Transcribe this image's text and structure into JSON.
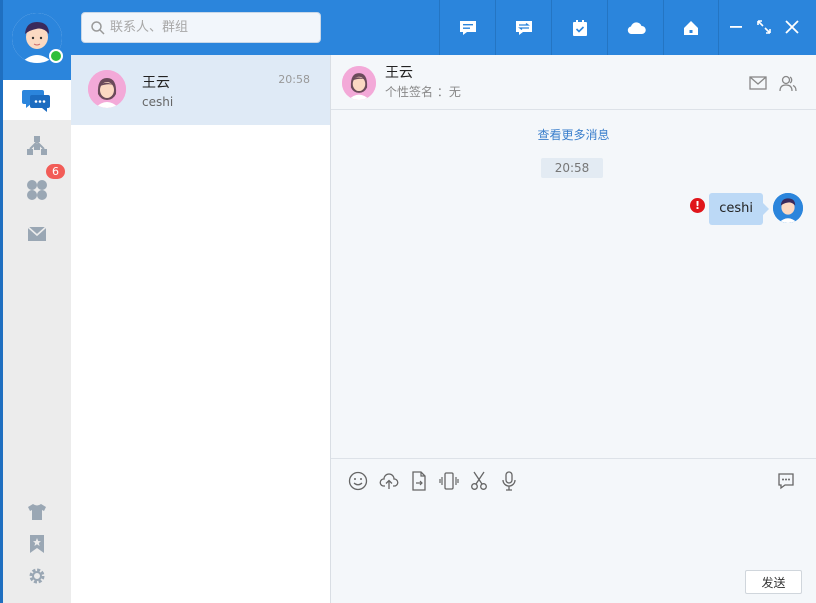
{
  "search": {
    "placeholder": "联系人、群组"
  },
  "sidebar": {
    "badge_count": "6"
  },
  "conversation": {
    "name": "王云",
    "time": "20:58",
    "last_message": "ceshi"
  },
  "chat": {
    "contact_name": "王云",
    "signature": "个性签名 ：无",
    "more_messages": "查看更多消息",
    "time_divider": "20:58",
    "message_text": "ceshi",
    "error_mark": "!",
    "send_label": "发送"
  },
  "colors": {
    "brand": "#2b85dc",
    "online": "#2fbf3b",
    "badge": "#f25c57",
    "error": "#e0161b",
    "bubble": "#bcd9f6"
  }
}
